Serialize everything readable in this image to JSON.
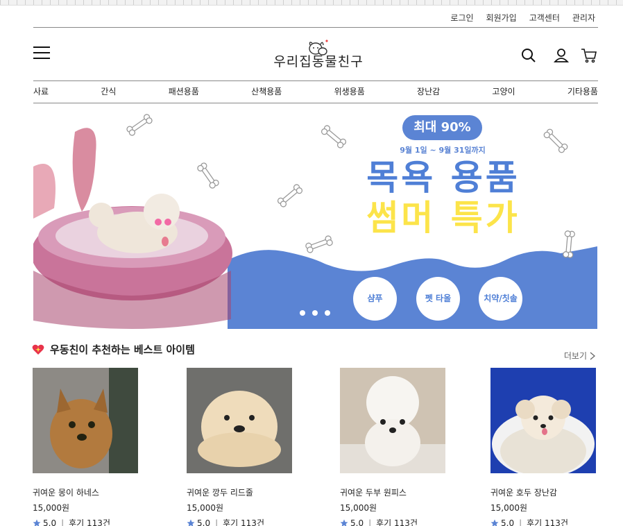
{
  "util_nav": [
    "로그인",
    "회원가입",
    "고객센터",
    "관리자"
  ],
  "brand": {
    "name": "우리집동물친구"
  },
  "categories": [
    "사료",
    "간식",
    "패션용품",
    "산책용품",
    "위생용품",
    "장난감",
    "고양이",
    "기타용품"
  ],
  "banner": {
    "badge": "최대 90%",
    "period": "9월 1일 ~ 9월 31일까지",
    "headline_line1": "목욕 용품",
    "headline_line2": "썸머 특가",
    "quick_links": [
      "샴푸",
      "펫 타올",
      "치약/칫솔"
    ],
    "slide_count": 3
  },
  "section": {
    "title": "우동친이 추천하는 베스트 아이템",
    "more_label": "더보기"
  },
  "products": [
    {
      "name": "귀여운 몽이 하네스",
      "price": "15,000원",
      "rating": "5.0",
      "reviews": "후기 113건"
    },
    {
      "name": "귀여운 깡두 리드줄",
      "price": "15,000원",
      "rating": "5.0",
      "reviews": "후기 113건"
    },
    {
      "name": "귀여운 두부 원피스",
      "price": "15,000원",
      "rating": "5.0",
      "reviews": "후기 113건"
    },
    {
      "name": "귀여운 호두 장난감",
      "price": "15,000원",
      "rating": "5.0",
      "reviews": "후기 113건"
    }
  ],
  "colors": {
    "accent_blue": "#5b84d4",
    "accent_yellow": "#fce44a",
    "star": "#5b84d4"
  },
  "icons": [
    "menu-icon",
    "search-icon",
    "user-icon",
    "cart-icon",
    "bone-icon",
    "heart-sparkle-icon",
    "chevron-right-icon",
    "star-icon"
  ]
}
